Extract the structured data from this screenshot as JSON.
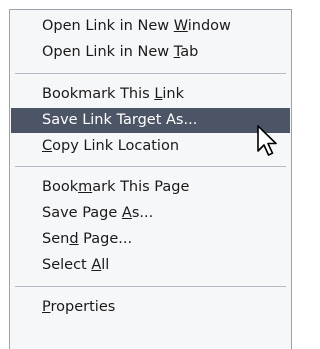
{
  "context_menu": {
    "items": [
      {
        "label": "Open Link in New Window",
        "accel_pre": "Open Link in New ",
        "accel_key": "W",
        "accel_post": "indow"
      },
      {
        "label": "Open Link in New Tab",
        "accel_pre": "Open Link in New ",
        "accel_key": "T",
        "accel_post": "ab"
      },
      {
        "label": "Bookmark This Link",
        "accel_pre": "Bookmark This ",
        "accel_key": "L",
        "accel_post": "ink"
      },
      {
        "label": "Save Link Target As...",
        "accel_pre": "Save Link Tar",
        "accel_key": "g",
        "accel_post": "et As...",
        "selected": true
      },
      {
        "label": "Copy Link Location",
        "accel_pre": "",
        "accel_key": "C",
        "accel_post": "opy Link Location"
      },
      {
        "label": "Bookmark This Page",
        "accel_pre": "Book",
        "accel_key": "m",
        "accel_post": "ark This Page"
      },
      {
        "label": "Save Page As...",
        "accel_pre": "Save Page ",
        "accel_key": "A",
        "accel_post": "s..."
      },
      {
        "label": "Send Page...",
        "accel_pre": "Sen",
        "accel_key": "d",
        "accel_post": " Page..."
      },
      {
        "label": "Select All",
        "accel_pre": "Select ",
        "accel_key": "A",
        "accel_post": "ll"
      },
      {
        "label": "Properties",
        "accel_pre": "",
        "accel_key": "P",
        "accel_post": "roperties"
      }
    ],
    "selected_bg_color": "#4c5565",
    "menu_bg_color": "#f6f7f9"
  },
  "cursor": {
    "icon": "arrow-pointer-icon"
  }
}
